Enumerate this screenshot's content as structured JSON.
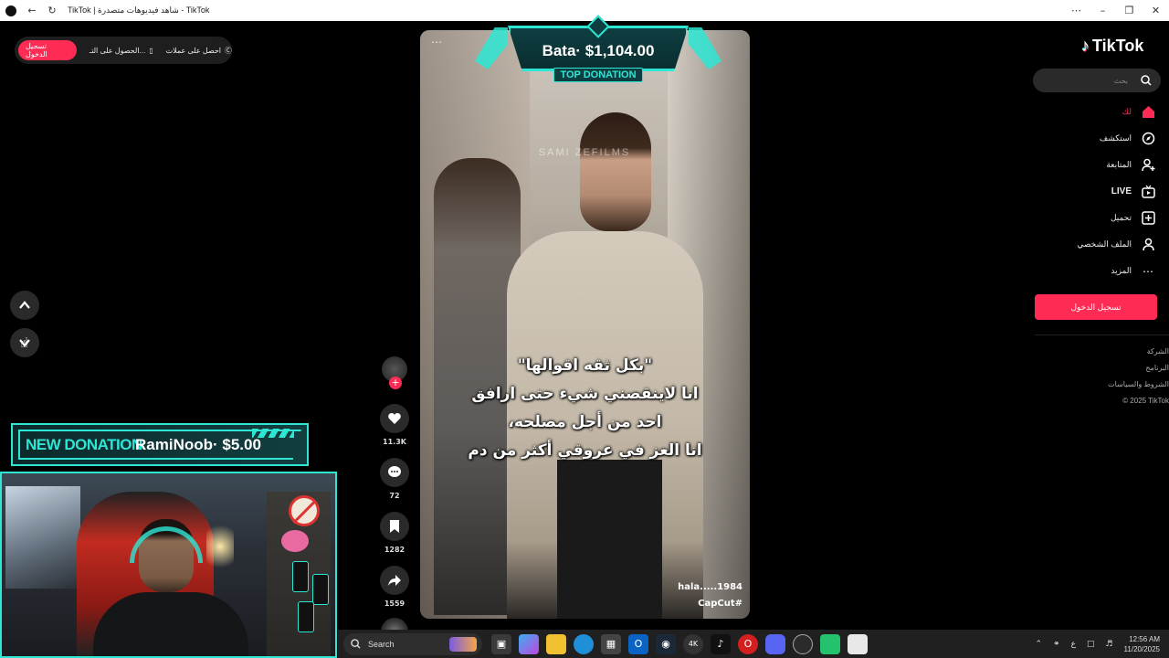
{
  "browser": {
    "title": "TikTok | شاهد فيديوهات متصدرة - TikTok"
  },
  "top_pill": {
    "login_label": "تسجيل الدخول",
    "app_label": "الحصول على التـ...",
    "coins_label": "احصل على عملات"
  },
  "overlay": {
    "top_donation_amount": "Bata· $1,104.00",
    "top_donation_label": "TOP DONATION",
    "new_donation_label": "NEW DONATION",
    "new_donation_amount": "RamiNoob· $5.00"
  },
  "video": {
    "watermark": "SAMI          ZEFILMS",
    "subtitles": [
      "\"بكل ثقه اقوالها\"",
      "انا لاينقصني شيء حتى ارافق",
      "احد من أجل مصلحه،",
      "انا العز في عروقي أكثر من دم"
    ],
    "author": "hala.....1984",
    "hashtag": "CapCut#"
  },
  "actions": {
    "likes": "11.3K",
    "comments": "72",
    "saves": "1282",
    "shares": "1559"
  },
  "sidebar": {
    "brand": "TikTok",
    "search_placeholder": "بحث",
    "items": [
      {
        "label": "لك",
        "icon": "home-icon"
      },
      {
        "label": "استكشف",
        "icon": "compass-icon"
      },
      {
        "label": "المتابعة",
        "icon": "following-icon"
      },
      {
        "label": "LIVE",
        "icon": "live-icon"
      },
      {
        "label": "تحميل",
        "icon": "upload-icon"
      },
      {
        "label": "الملف الشخصي",
        "icon": "profile-icon"
      },
      {
        "label": "المزيد",
        "icon": "more-icon"
      }
    ],
    "login_button": "تسجيل الدخول",
    "footer": [
      "الشركة",
      "البرنامج",
      "الشروط والسياسات",
      "© 2025 TikTok"
    ]
  },
  "taskbar": {
    "search_label": "Search",
    "lang": "ع",
    "time": "12:56 AM",
    "date": "11/20/2025"
  },
  "colors": {
    "accent": "#fe2c55",
    "overlay_cyan": "#2ee6d4"
  }
}
